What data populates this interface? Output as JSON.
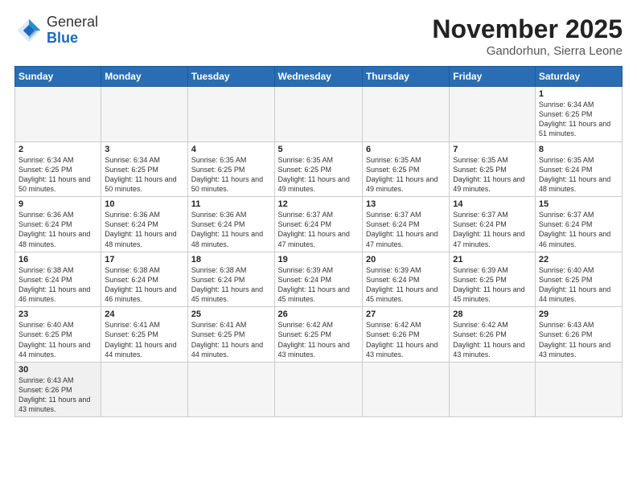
{
  "header": {
    "logo_general": "General",
    "logo_blue": "Blue",
    "month": "November 2025",
    "location": "Gandorhun, Sierra Leone"
  },
  "weekdays": [
    "Sunday",
    "Monday",
    "Tuesday",
    "Wednesday",
    "Thursday",
    "Friday",
    "Saturday"
  ],
  "weeks": [
    [
      {
        "day": "",
        "info": ""
      },
      {
        "day": "",
        "info": ""
      },
      {
        "day": "",
        "info": ""
      },
      {
        "day": "",
        "info": ""
      },
      {
        "day": "",
        "info": ""
      },
      {
        "day": "",
        "info": ""
      },
      {
        "day": "1",
        "info": "Sunrise: 6:34 AM\nSunset: 6:25 PM\nDaylight: 11 hours\nand 51 minutes."
      }
    ],
    [
      {
        "day": "2",
        "info": "Sunrise: 6:34 AM\nSunset: 6:25 PM\nDaylight: 11 hours\nand 50 minutes."
      },
      {
        "day": "3",
        "info": "Sunrise: 6:34 AM\nSunset: 6:25 PM\nDaylight: 11 hours\nand 50 minutes."
      },
      {
        "day": "4",
        "info": "Sunrise: 6:35 AM\nSunset: 6:25 PM\nDaylight: 11 hours\nand 50 minutes."
      },
      {
        "day": "5",
        "info": "Sunrise: 6:35 AM\nSunset: 6:25 PM\nDaylight: 11 hours\nand 49 minutes."
      },
      {
        "day": "6",
        "info": "Sunrise: 6:35 AM\nSunset: 6:25 PM\nDaylight: 11 hours\nand 49 minutes."
      },
      {
        "day": "7",
        "info": "Sunrise: 6:35 AM\nSunset: 6:25 PM\nDaylight: 11 hours\nand 49 minutes."
      },
      {
        "day": "8",
        "info": "Sunrise: 6:35 AM\nSunset: 6:24 PM\nDaylight: 11 hours\nand 48 minutes."
      }
    ],
    [
      {
        "day": "9",
        "info": "Sunrise: 6:36 AM\nSunset: 6:24 PM\nDaylight: 11 hours\nand 48 minutes."
      },
      {
        "day": "10",
        "info": "Sunrise: 6:36 AM\nSunset: 6:24 PM\nDaylight: 11 hours\nand 48 minutes."
      },
      {
        "day": "11",
        "info": "Sunrise: 6:36 AM\nSunset: 6:24 PM\nDaylight: 11 hours\nand 48 minutes."
      },
      {
        "day": "12",
        "info": "Sunrise: 6:37 AM\nSunset: 6:24 PM\nDaylight: 11 hours\nand 47 minutes."
      },
      {
        "day": "13",
        "info": "Sunrise: 6:37 AM\nSunset: 6:24 PM\nDaylight: 11 hours\nand 47 minutes."
      },
      {
        "day": "14",
        "info": "Sunrise: 6:37 AM\nSunset: 6:24 PM\nDaylight: 11 hours\nand 47 minutes."
      },
      {
        "day": "15",
        "info": "Sunrise: 6:37 AM\nSunset: 6:24 PM\nDaylight: 11 hours\nand 46 minutes."
      }
    ],
    [
      {
        "day": "16",
        "info": "Sunrise: 6:38 AM\nSunset: 6:24 PM\nDaylight: 11 hours\nand 46 minutes."
      },
      {
        "day": "17",
        "info": "Sunrise: 6:38 AM\nSunset: 6:24 PM\nDaylight: 11 hours\nand 46 minutes."
      },
      {
        "day": "18",
        "info": "Sunrise: 6:38 AM\nSunset: 6:24 PM\nDaylight: 11 hours\nand 45 minutes."
      },
      {
        "day": "19",
        "info": "Sunrise: 6:39 AM\nSunset: 6:24 PM\nDaylight: 11 hours\nand 45 minutes."
      },
      {
        "day": "20",
        "info": "Sunrise: 6:39 AM\nSunset: 6:24 PM\nDaylight: 11 hours\nand 45 minutes."
      },
      {
        "day": "21",
        "info": "Sunrise: 6:39 AM\nSunset: 6:25 PM\nDaylight: 11 hours\nand 45 minutes."
      },
      {
        "day": "22",
        "info": "Sunrise: 6:40 AM\nSunset: 6:25 PM\nDaylight: 11 hours\nand 44 minutes."
      }
    ],
    [
      {
        "day": "23",
        "info": "Sunrise: 6:40 AM\nSunset: 6:25 PM\nDaylight: 11 hours\nand 44 minutes."
      },
      {
        "day": "24",
        "info": "Sunrise: 6:41 AM\nSunset: 6:25 PM\nDaylight: 11 hours\nand 44 minutes."
      },
      {
        "day": "25",
        "info": "Sunrise: 6:41 AM\nSunset: 6:25 PM\nDaylight: 11 hours\nand 44 minutes."
      },
      {
        "day": "26",
        "info": "Sunrise: 6:42 AM\nSunset: 6:25 PM\nDaylight: 11 hours\nand 43 minutes."
      },
      {
        "day": "27",
        "info": "Sunrise: 6:42 AM\nSunset: 6:26 PM\nDaylight: 11 hours\nand 43 minutes."
      },
      {
        "day": "28",
        "info": "Sunrise: 6:42 AM\nSunset: 6:26 PM\nDaylight: 11 hours\nand 43 minutes."
      },
      {
        "day": "29",
        "info": "Sunrise: 6:43 AM\nSunset: 6:26 PM\nDaylight: 11 hours\nand 43 minutes."
      }
    ],
    [
      {
        "day": "30",
        "info": "Sunrise: 6:43 AM\nSunset: 6:26 PM\nDaylight: 11 hours\nand 43 minutes."
      },
      {
        "day": "",
        "info": ""
      },
      {
        "day": "",
        "info": ""
      },
      {
        "day": "",
        "info": ""
      },
      {
        "day": "",
        "info": ""
      },
      {
        "day": "",
        "info": ""
      },
      {
        "day": "",
        "info": ""
      }
    ]
  ]
}
